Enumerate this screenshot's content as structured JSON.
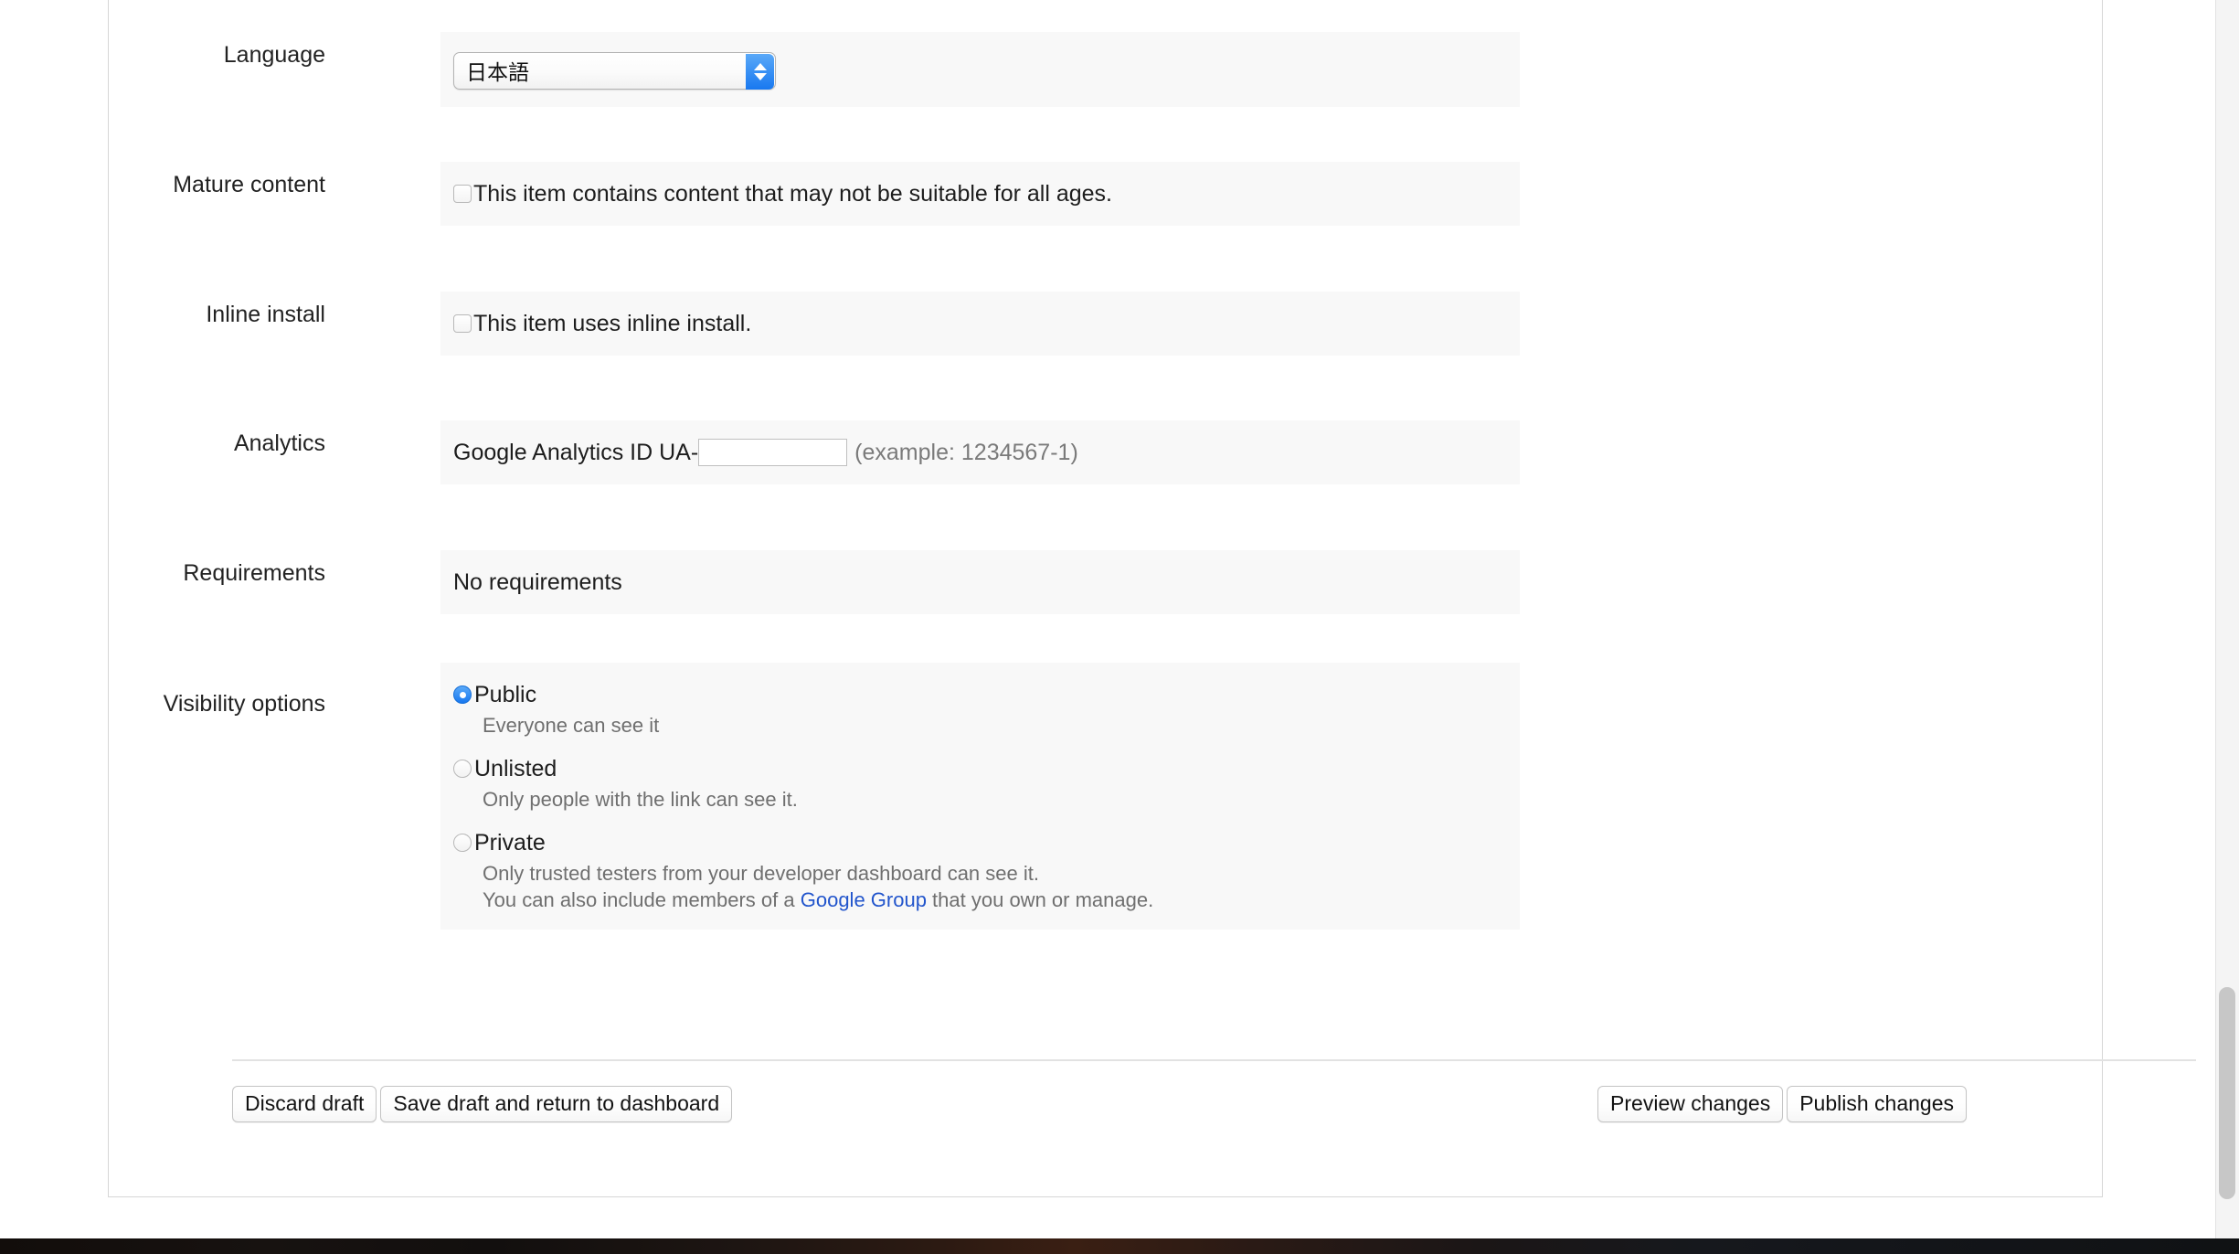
{
  "form": {
    "rows": [
      {
        "id": "language",
        "label": "Language",
        "type": "select",
        "value": "日本語"
      },
      {
        "id": "mature-content",
        "label": "Mature content",
        "type": "checkbox",
        "checkbox_label": "This item contains content that may not be suitable for all ages.",
        "checked": false
      },
      {
        "id": "inline-install",
        "label": "Inline install",
        "type": "checkbox",
        "checkbox_label": "This item uses inline install.",
        "checked": false
      },
      {
        "id": "analytics",
        "label": "Analytics",
        "type": "analytics",
        "prefix_label": "Google Analytics ID UA-",
        "input_value": "",
        "input_placeholder": "",
        "example_text": "(example: 1234567-1)"
      },
      {
        "id": "requirements",
        "label": "Requirements",
        "type": "text",
        "value": "No requirements"
      },
      {
        "id": "visibility-options",
        "label": "Visibility options",
        "type": "radio"
      }
    ]
  },
  "visibility": {
    "options": [
      {
        "label": "Public",
        "selected": true,
        "description": "Everyone can see it",
        "description2": "",
        "link_text": "",
        "description2_suffix": ""
      },
      {
        "label": "Unlisted",
        "selected": false,
        "description": "Only people with the link can see it.",
        "description2": "",
        "link_text": "",
        "description2_suffix": ""
      },
      {
        "label": "Private",
        "selected": false,
        "description": "Only trusted testers from your developer dashboard can see it.",
        "description2": "You can also include members of a ",
        "link_text": "Google Group",
        "description2_suffix": " that you own or manage."
      }
    ]
  },
  "footer": {
    "discard_draft": "Discard draft",
    "save_draft": "Save draft and return to dashboard",
    "preview_changes": "Preview changes",
    "publish_changes": "Publish changes"
  },
  "colors": {
    "accent_blue": "#1878f0",
    "link_blue": "#2255cc",
    "field_bg": "#f8f8f8",
    "muted_text": "#6f6f6f"
  }
}
